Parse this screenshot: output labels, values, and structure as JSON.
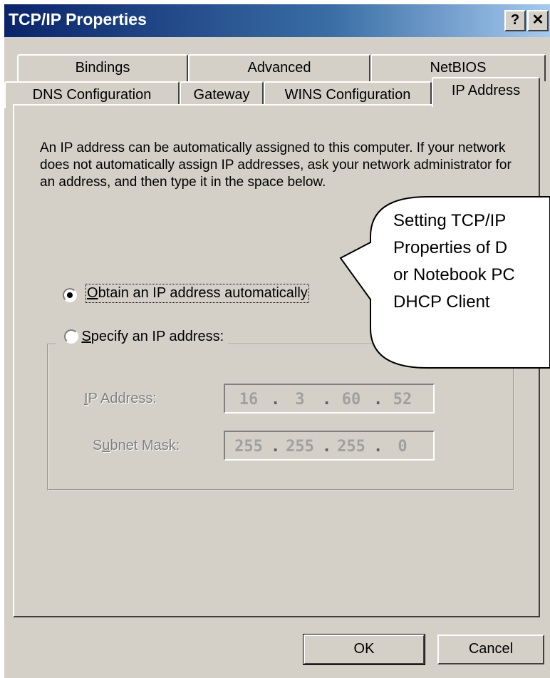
{
  "window": {
    "title": "TCP/IP Properties",
    "help_btn": "?",
    "close_btn": "✕"
  },
  "tabs_row1": [
    "Bindings",
    "Advanced",
    "NetBIOS"
  ],
  "tabs_row2": [
    "DNS Configuration",
    "Gateway",
    "WINS Configuration",
    "IP Address"
  ],
  "description": "An IP address can be automatically assigned to this computer. If your network does not automatically assign IP addresses, ask your network administrator for an address, and then type it in the space below.",
  "options": {
    "auto": {
      "ak": "O",
      "rest": "btain an IP address automatically",
      "selected": true
    },
    "specify": {
      "ak": "S",
      "rest": "pecify an IP address:",
      "selected": false
    }
  },
  "fields": {
    "ip": {
      "label_pre": "",
      "ak": "I",
      "label_post": "P Address:",
      "octets": [
        "16",
        "3",
        "60",
        "52"
      ]
    },
    "mask": {
      "label_pre": "S",
      "ak": "u",
      "label_post": "bnet Mask:",
      "octets": [
        "255",
        "255",
        "255",
        "0"
      ]
    }
  },
  "buttons": {
    "ok": "OK",
    "cancel": "Cancel"
  },
  "callout": {
    "lines": [
      "Setting TCP/IP",
      "Properties of D",
      "or Notebook PC",
      "DHCP Client"
    ]
  }
}
